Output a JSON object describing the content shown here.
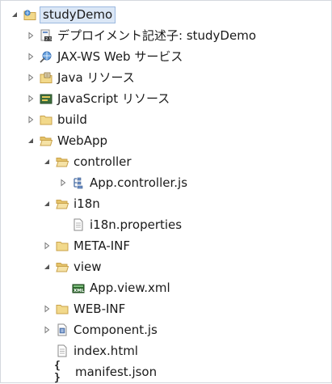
{
  "tree": {
    "root": {
      "label": "studyDemo"
    },
    "deployment_descriptor": {
      "label": "デプロイメント記述子: studyDemo"
    },
    "jaxws": {
      "label": "JAX-WS Web サービス"
    },
    "java_resources": {
      "label": "Java リソース"
    },
    "javascript_resources": {
      "label": "JavaScript リソース"
    },
    "build": {
      "label": "build"
    },
    "webapp": {
      "label": "WebApp"
    },
    "controller": {
      "label": "controller"
    },
    "app_controller": {
      "label": "App.controller.js"
    },
    "i18n": {
      "label": "i18n"
    },
    "i18n_properties": {
      "label": "i18n.properties"
    },
    "meta_inf": {
      "label": "META-INF"
    },
    "view": {
      "label": "view"
    },
    "app_view": {
      "label": "App.view.xml"
    },
    "web_inf": {
      "label": "WEB-INF"
    },
    "component": {
      "label": "Component.js"
    },
    "index_html": {
      "label": "index.html"
    },
    "manifest": {
      "label": "manifest.json",
      "icon_text": "{ }"
    }
  },
  "colors": {
    "selection_bg": "#dbe7f6",
    "selection_border": "#9cb9e0",
    "folder_fill": "#f2d98b",
    "folder_stroke": "#c9a24a"
  }
}
